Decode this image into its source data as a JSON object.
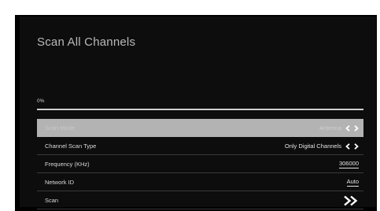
{
  "screen": {
    "title": "Scan All Channels",
    "progress": {
      "label": "0%",
      "value": 0
    },
    "menu": {
      "items": [
        {
          "label": "Scan Mode",
          "value": "Antenna",
          "control": "arrows",
          "selected": true
        },
        {
          "label": "Channel Scan Type",
          "value": "Only Digital Channels",
          "control": "arrows",
          "selected": false
        },
        {
          "label": "Frequency (KHz)",
          "value": "306000",
          "control": "field",
          "selected": false
        },
        {
          "label": "Network ID",
          "value": "Auto",
          "control": "field",
          "selected": false
        },
        {
          "label": "Scan",
          "value": "",
          "control": "go",
          "selected": false
        }
      ]
    },
    "icons": {
      "arrows": "left-right-arrows-icon",
      "go": "double-chevron-right-icon"
    },
    "colors": {
      "background": "#0d0d0d",
      "selected_row": "#b3b3b3",
      "text": "#d9d9d9"
    }
  }
}
